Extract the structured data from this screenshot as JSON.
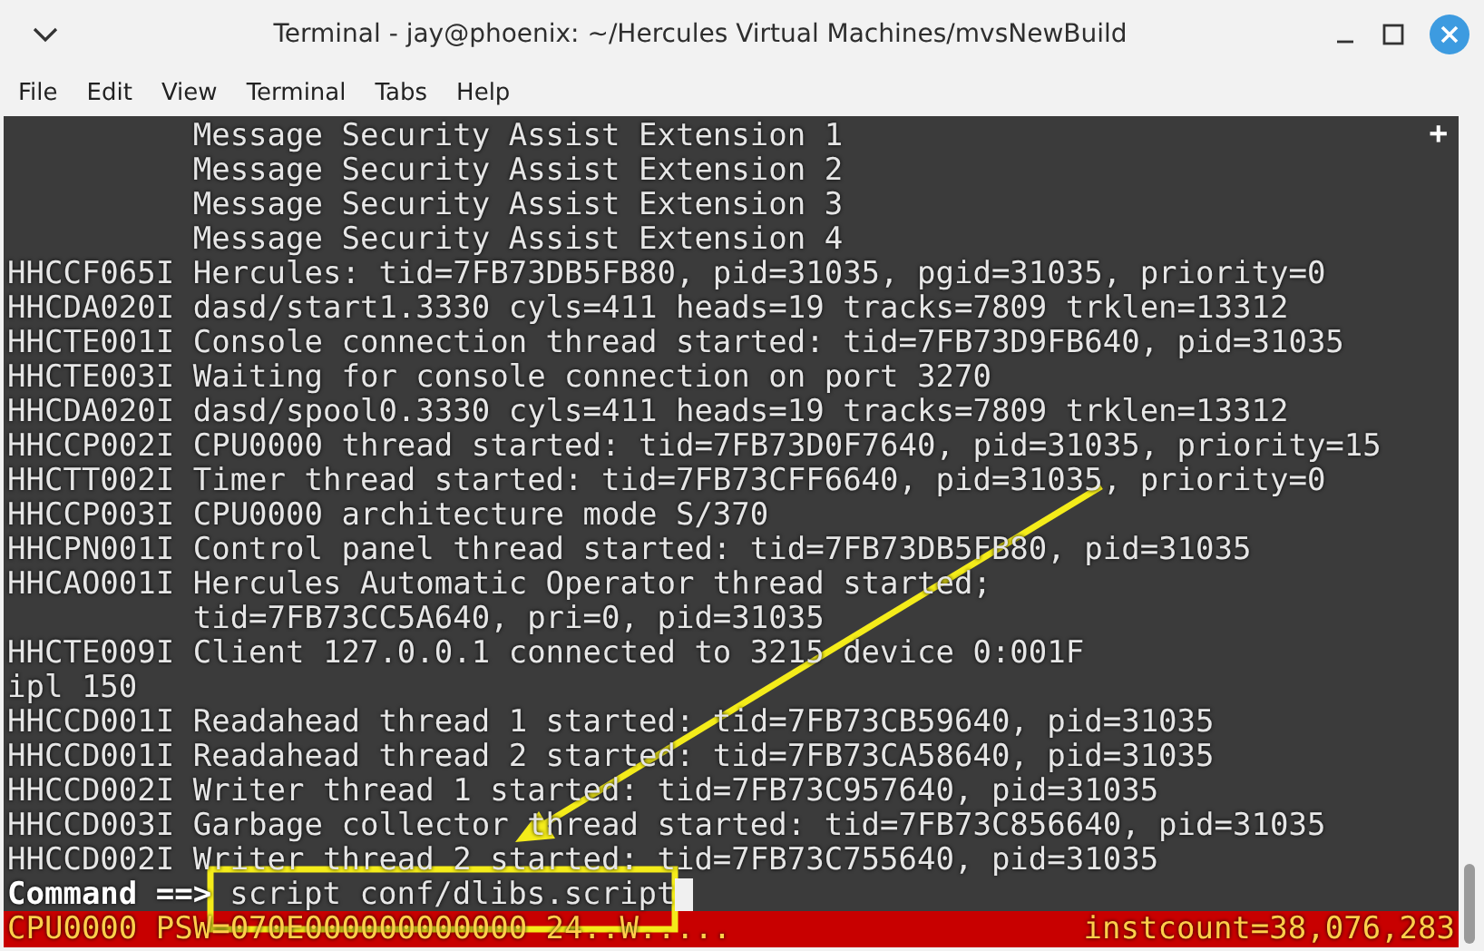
{
  "window": {
    "title": "Terminal - jay@phoenix: ~/Hercules Virtual Machines/mvsNewBuild"
  },
  "menu": [
    "File",
    "Edit",
    "View",
    "Terminal",
    "Tabs",
    "Help"
  ],
  "new_tab_button": "+",
  "lines": [
    "          Message Security Assist Extension 1",
    "          Message Security Assist Extension 2",
    "          Message Security Assist Extension 3",
    "          Message Security Assist Extension 4",
    "HHCCF065I Hercules: tid=7FB73DB5FB80, pid=31035, pgid=31035, priority=0",
    "HHCDA020I dasd/start1.3330 cyls=411 heads=19 tracks=7809 trklen=13312",
    "HHCTE001I Console connection thread started: tid=7FB73D9FB640, pid=31035",
    "HHCTE003I Waiting for console connection on port 3270",
    "HHCDA020I dasd/spool0.3330 cyls=411 heads=19 tracks=7809 trklen=13312",
    "HHCCP002I CPU0000 thread started: tid=7FB73D0F7640, pid=31035, priority=15",
    "HHCTT002I Timer thread started: tid=7FB73CFF6640, pid=31035, priority=0",
    "HHCCP003I CPU0000 architecture mode S/370",
    "HHCPN001I Control panel thread started: tid=7FB73DB5FB80, pid=31035",
    "HHCAO001I Hercules Automatic Operator thread started;",
    "          tid=7FB73CC5A640, pri=0, pid=31035",
    "HHCTE009I Client 127.0.0.1 connected to 3215 device 0:001F",
    "ipl 150",
    "HHCCD001I Readahead thread 1 started: tid=7FB73CB59640, pid=31035",
    "HHCCD001I Readahead thread 2 started: tid=7FB73CA58640, pid=31035",
    "HHCCD002I Writer thread 1 started: tid=7FB73C957640, pid=31035",
    "HHCCD003I Garbage collector thread started: tid=7FB73C856640, pid=31035",
    "HHCCD002I Writer thread 2 started: tid=7FB73C755640, pid=31035"
  ],
  "command": {
    "prompt": "Command ==>",
    "value": "script conf/dlibs.script"
  },
  "status_bar": {
    "left": "CPU0000 PSW=070E000000000000 24..W.....",
    "right": "instcount=38,076,283"
  }
}
